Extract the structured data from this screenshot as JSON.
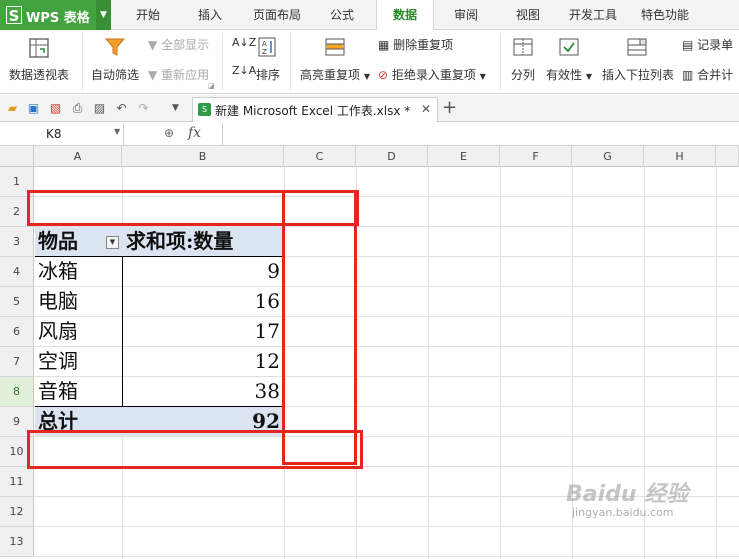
{
  "app": {
    "logo_label": "WPS 表格"
  },
  "menu": {
    "tabs": [
      {
        "label": "开始"
      },
      {
        "label": "插入"
      },
      {
        "label": "页面布局"
      },
      {
        "label": "公式"
      },
      {
        "label": "数据"
      },
      {
        "label": "审阅"
      },
      {
        "label": "视图"
      },
      {
        "label": "开发工具"
      },
      {
        "label": "特色功能"
      }
    ],
    "active_tab": "数据"
  },
  "ribbon": {
    "pivot": "数据透视表",
    "auto_filter": "自动筛选",
    "show_all": "全部显示",
    "reapply": "重新应用",
    "sort": "排序",
    "highlight_dup": "高亮重复项",
    "remove_dup": "删除重复项",
    "reject_dup": "拒绝录入重复项",
    "split": "分列",
    "validity": "有效性",
    "insert_dropdown": "插入下拉列表",
    "record_form": "记录单",
    "merge_calc": "合并计"
  },
  "document": {
    "tab_title": "新建 Microsoft Excel 工作表.xlsx *"
  },
  "formula_bar": {
    "name_box": "K8",
    "fx_label": "fx"
  },
  "grid": {
    "columns": [
      "A",
      "B",
      "C",
      "D",
      "E",
      "F",
      "G",
      "H"
    ],
    "rows": [
      "1",
      "2",
      "3",
      "4",
      "5",
      "6",
      "7",
      "8",
      "9",
      "10",
      "11",
      "12",
      "13"
    ],
    "selected_row": "8"
  },
  "pivot_table": {
    "header_item": "物品",
    "header_value": "求和项:数量",
    "rows": [
      {
        "item": "冰箱",
        "qty": "9"
      },
      {
        "item": "电脑",
        "qty": "16"
      },
      {
        "item": "风扇",
        "qty": "17"
      },
      {
        "item": "空调",
        "qty": "12"
      },
      {
        "item": "音箱",
        "qty": "38"
      }
    ],
    "total_label": "总计",
    "total_value": "92"
  },
  "watermark": {
    "brand": "Baidu 经验",
    "url": "jingyan.baidu.com"
  },
  "colors": {
    "brand_green": "#42a33f",
    "highlight_red": "#e5261f",
    "pivot_header": "#dbe5f1"
  }
}
